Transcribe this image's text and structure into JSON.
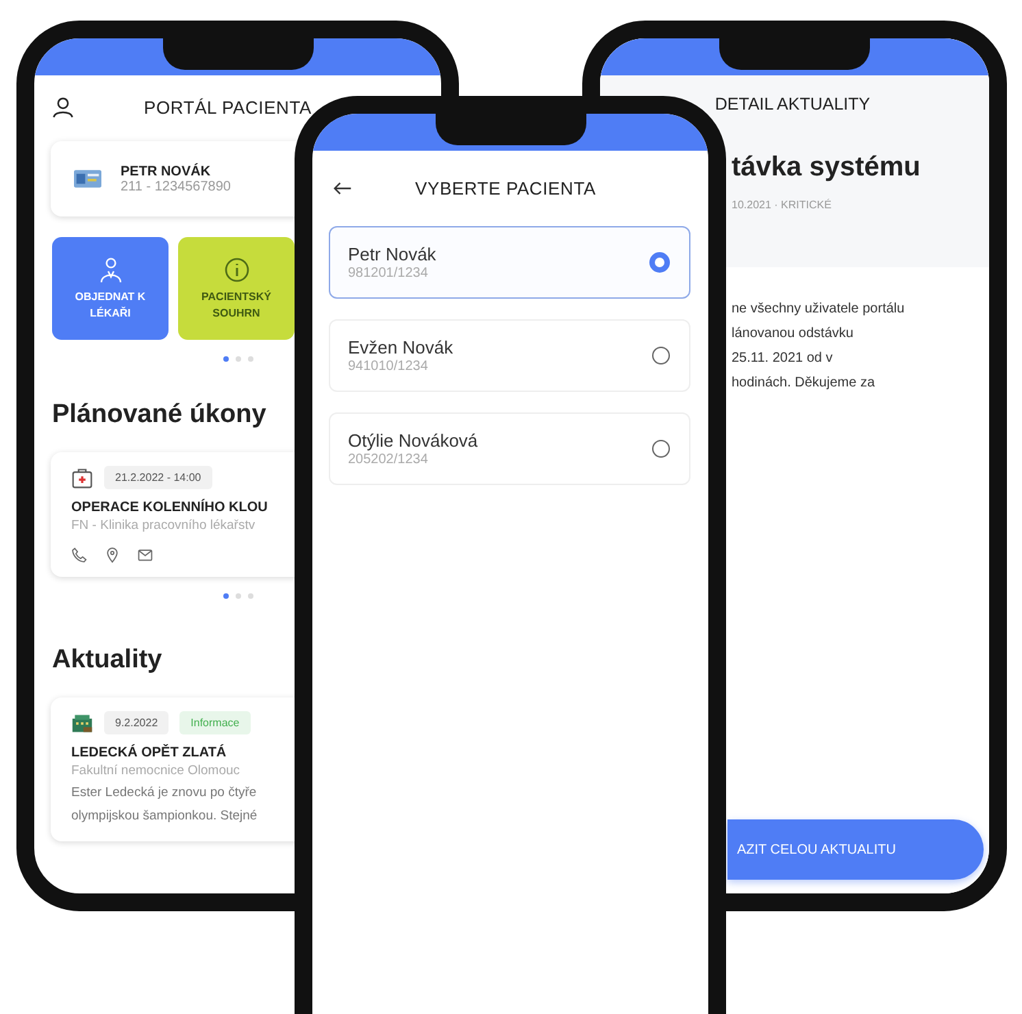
{
  "home_screen": {
    "title": "PORTÁL PACIENTA",
    "patient_card": {
      "name": "PETR NOVÁK",
      "number": "211 - 1234567890"
    },
    "tiles": [
      {
        "kind": "doctor",
        "label": "OBJEDNAT K LÉKAŘI",
        "color": "#4f7df5"
      },
      {
        "kind": "info",
        "label": "PACIENTSKÝ SOUHRN",
        "color": "#c6dc3c"
      }
    ],
    "tiles_pager": [
      {
        "selected": true
      },
      {
        "selected": false
      },
      {
        "selected": false
      }
    ],
    "planned_title": "Plánované úkony",
    "appointment": {
      "date_time": "21.2.2022 - 14:00",
      "title": "OPERACE KOLENNÍHO KLOU",
      "place": "FN - Klinika pracovního lékařstv"
    },
    "appointment_pager": [
      {
        "selected": true
      },
      {
        "selected": false
      },
      {
        "selected": false
      }
    ],
    "news_title": "Aktuality",
    "news": {
      "date": "9.2.2022",
      "tag": "Informace",
      "title": "LEDECKÁ OPĚT ZLATÁ",
      "source": "Fakultní nemocnice Olomouc",
      "excerpt_lines": [
        "Ester Ledecká je znovu po čtyře",
        "olympijskou šampionkou. Stejné"
      ]
    }
  },
  "patient_picker": {
    "title": "VYBERTE PACIENTA",
    "patients": [
      {
        "name": "Petr Novák",
        "id_number": "981201/1234",
        "selected": true
      },
      {
        "name": "Evžen Novák",
        "id_number": "941010/1234",
        "selected": false
      },
      {
        "name": "Otýlie Nováková",
        "id_number": "205202/1234",
        "selected": false
      }
    ]
  },
  "news_detail": {
    "title": "DETAIL AKTUALITY",
    "headline": "távka systému",
    "meta": "10.2021 · KRITICKÉ",
    "body_lines": [
      "ne všechny uživatele portálu",
      "lánovanou odstávku",
      "25.11. 2021 od v",
      "hodinách. Děkujeme za"
    ],
    "button": "AZIT CELOU AKTUALITU"
  }
}
